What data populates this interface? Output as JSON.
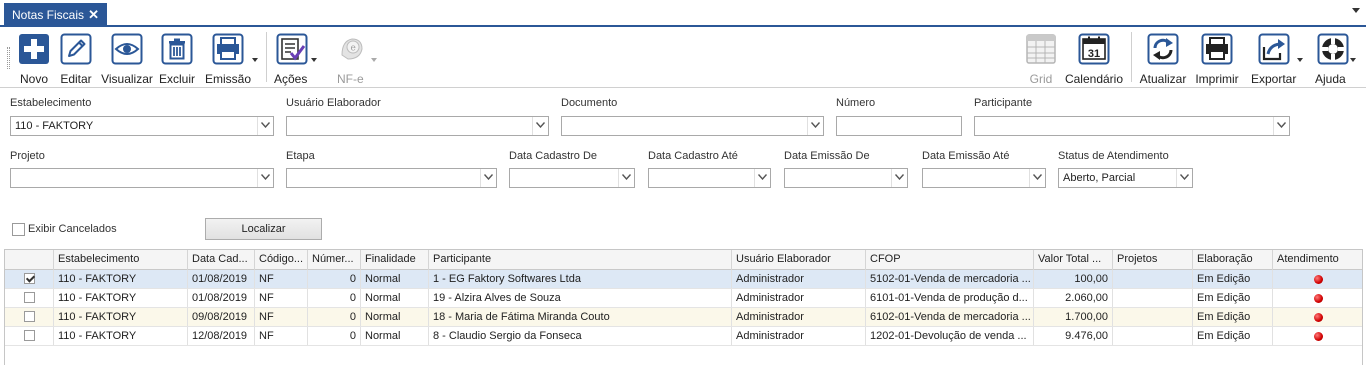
{
  "tab": {
    "title": "Notas Fiscais",
    "close": "✕"
  },
  "toolbar": {
    "left": [
      {
        "label": "Novo",
        "icon": "plus-icon"
      },
      {
        "label": "Editar",
        "icon": "pencil-icon"
      },
      {
        "label": "Visualizar",
        "icon": "eye-icon"
      },
      {
        "label": "Excluir",
        "icon": "trash-icon"
      },
      {
        "label": "Emissão",
        "icon": "printer-icon"
      },
      {
        "label": "Ações",
        "icon": "checklist-icon"
      },
      {
        "label": "NF-e",
        "icon": "nfe-icon",
        "disabled": true
      }
    ],
    "right": [
      {
        "label": "Grid",
        "icon": "grid-icon",
        "disabled": true
      },
      {
        "label": "Calendário",
        "icon": "calendar-icon",
        "day": "31"
      },
      {
        "label": "Atualizar",
        "icon": "refresh-icon"
      },
      {
        "label": "Imprimir",
        "icon": "printer-icon"
      },
      {
        "label": "Exportar",
        "icon": "export-icon"
      },
      {
        "label": "Ajuda",
        "icon": "help-icon"
      }
    ]
  },
  "filters": {
    "estabelecimento": {
      "label": "Estabelecimento",
      "value": "110 - FAKTORY"
    },
    "usuario": {
      "label": "Usuário Elaborador",
      "value": ""
    },
    "documento": {
      "label": "Documento",
      "value": ""
    },
    "numero": {
      "label": "Número",
      "value": ""
    },
    "participante": {
      "label": "Participante",
      "value": ""
    },
    "projeto": {
      "label": "Projeto",
      "value": ""
    },
    "etapa": {
      "label": "Etapa",
      "value": ""
    },
    "cad_de": {
      "label": "Data Cadastro De",
      "value": ""
    },
    "cad_ate": {
      "label": "Data Cadastro Até",
      "value": ""
    },
    "emi_de": {
      "label": "Data Emissão De",
      "value": ""
    },
    "emi_ate": {
      "label": "Data Emissão Até",
      "value": ""
    },
    "status": {
      "label": "Status de Atendimento",
      "value": "Aberto, Parcial"
    },
    "exibir_cancelados": {
      "label": "Exibir Cancelados",
      "checked": false
    },
    "localizar": "Localizar"
  },
  "grid": {
    "columns": [
      "",
      "Estabelecimento",
      "Data Cad...",
      "Código...",
      "Númer...",
      "Finalidade",
      "Participante",
      "Usuário Elaborador",
      "CFOP",
      "Valor Total ...",
      "Projetos",
      "Elaboração",
      "Atendimento"
    ],
    "rows": [
      {
        "checked": true,
        "estab": "110 - FAKTORY",
        "data": "01/08/2019",
        "codigo": "NF",
        "numero": "0",
        "finalidade": "Normal",
        "participante": "1 - EG Faktory Softwares Ltda",
        "usuario": "Administrador",
        "cfop": "5102-01-Venda de mercadoria ...",
        "valor": "100,00",
        "projetos": "",
        "elaboracao": "Em Edição",
        "atendimento": "red"
      },
      {
        "checked": false,
        "estab": "110 - FAKTORY",
        "data": "01/08/2019",
        "codigo": "NF",
        "numero": "0",
        "finalidade": "Normal",
        "participante": "19 - Alzira Alves de Souza",
        "usuario": "Administrador",
        "cfop": "6101-01-Venda de produção d...",
        "valor": "2.060,00",
        "projetos": "",
        "elaboracao": "Em Edição",
        "atendimento": "red"
      },
      {
        "checked": false,
        "estab": "110 - FAKTORY",
        "data": "09/08/2019",
        "codigo": "NF",
        "numero": "0",
        "finalidade": "Normal",
        "participante": "18 - Maria de Fátima Miranda Couto",
        "usuario": "Administrador",
        "cfop": "6102-01-Venda de mercadoria ...",
        "valor": "1.700,00",
        "projetos": "",
        "elaboracao": "Em Edição",
        "atendimento": "red"
      },
      {
        "checked": false,
        "estab": "110 - FAKTORY",
        "data": "12/08/2019",
        "codigo": "NF",
        "numero": "0",
        "finalidade": "Normal",
        "participante": "8 - Claudio Sergio da Fonseca",
        "usuario": "Administrador",
        "cfop": "1202-01-Devolução de venda ...",
        "valor": "9.476,00",
        "projetos": "",
        "elaboracao": "Em Edição",
        "atendimento": "red"
      }
    ]
  },
  "colors": {
    "accent": "#2b5797",
    "selected_row": "#dde8f5",
    "alt_row": "#fbf8ea",
    "status_red": "#d10000"
  }
}
